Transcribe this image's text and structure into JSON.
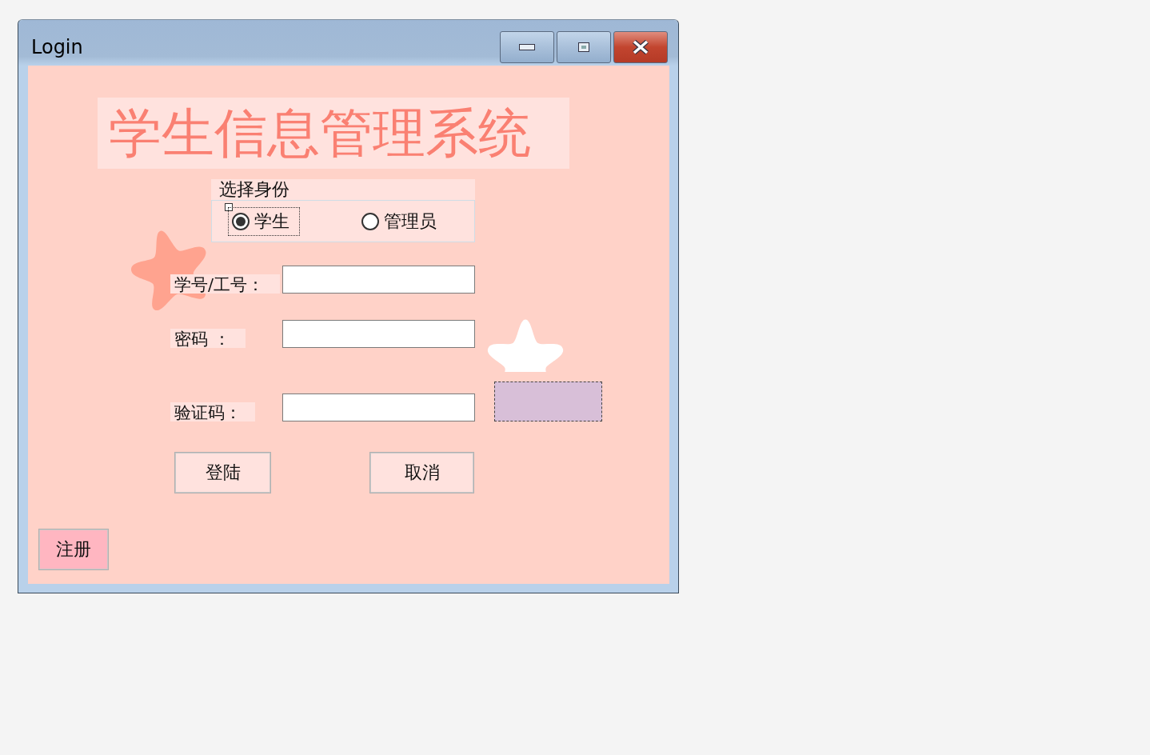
{
  "window": {
    "title": "Login"
  },
  "banner": "学生信息管理系统",
  "identity": {
    "legend": "选择身份",
    "options": [
      {
        "label": "学生",
        "selected": true
      },
      {
        "label": "管理员",
        "selected": false
      }
    ]
  },
  "fields": [
    {
      "label": "学号/工号："
    },
    {
      "label": "密码 ："
    },
    {
      "label": "验证码："
    }
  ],
  "buttons": [
    "登陆",
    "取消"
  ],
  "register": "注册"
}
